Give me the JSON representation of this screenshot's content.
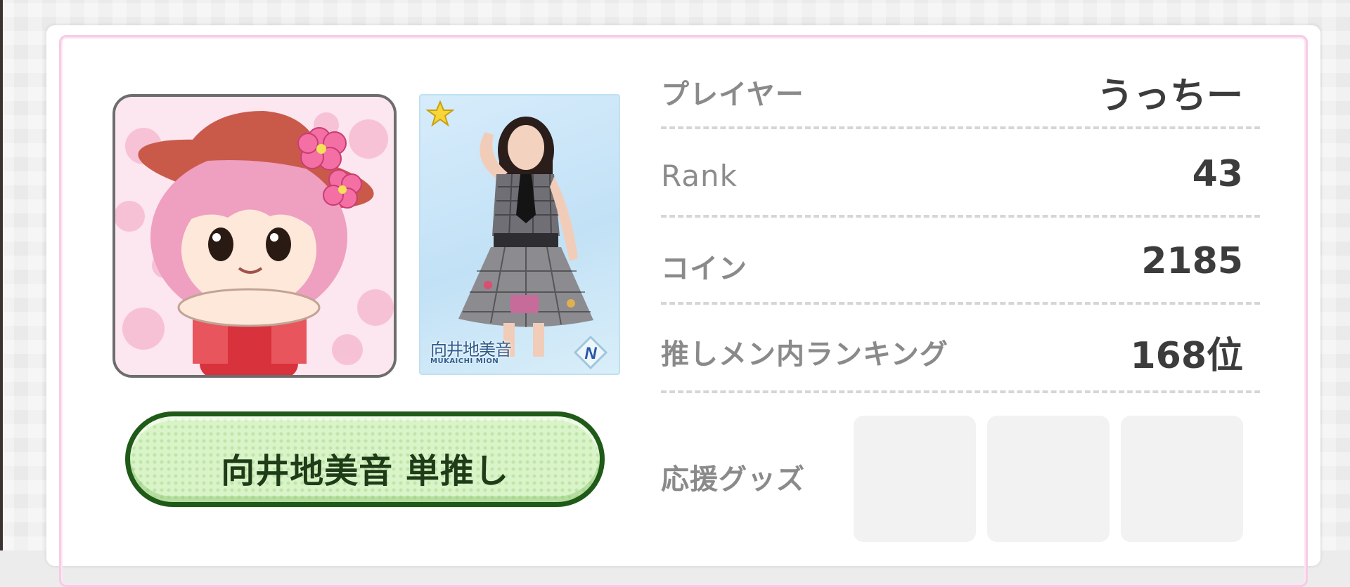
{
  "player": {
    "avatar_icon": "avatar-character-icon",
    "card": {
      "member_name": "向井地美音",
      "member_romaji": "MUKAICHI MION",
      "rarity": "N",
      "star_icon": "star-icon"
    },
    "oshi_button_label": "向井地美音 単推し"
  },
  "stats": [
    {
      "label": "プレイヤー",
      "value": "うっちー"
    },
    {
      "label": "Rank",
      "value": "43"
    },
    {
      "label": "コイン",
      "value": "2185"
    },
    {
      "label": "推しメン内ランキング",
      "value": "168位"
    }
  ],
  "goods": {
    "label": "応援グッズ",
    "slots": [
      "",
      "",
      ""
    ]
  },
  "colors": {
    "panel_border": "#f7cbe6",
    "button_border": "#1f5a18",
    "button_fill": "#d9f4c9",
    "label_gray": "#8a8a8a",
    "value_dark": "#3c3c3c"
  }
}
